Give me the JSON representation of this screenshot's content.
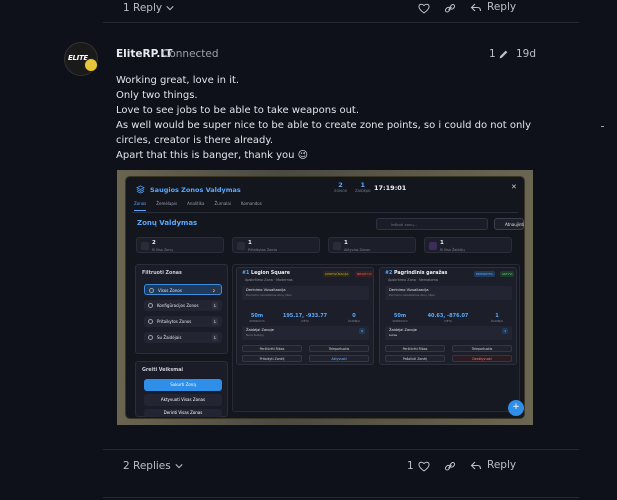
{
  "top_actions": {
    "replies_label": "1 Reply",
    "reply_label": "Reply"
  },
  "post": {
    "username": "EliteRP.LT",
    "status": "Connected",
    "avatar_text": "ELITE",
    "edit_count": "1",
    "date": "19d",
    "body": [
      "Working great, love in it.",
      "Only two things.",
      "Love to see jobs to be able to take weapons out.",
      "As well would be super nice to be able to create zone points, so i could do not only circles, creator is there already.",
      "Apart that this is banger, thank you 😉"
    ]
  },
  "screenshot": {
    "title": "Saugios Zonos Valdymas",
    "header_stats": [
      {
        "value": "2",
        "label": "ZONOS"
      },
      {
        "value": "1",
        "label": "ŽAIDĖJAI"
      }
    ],
    "clock": "17:19:01",
    "tabs": [
      "Zonos",
      "Žemėlapis",
      "Analitika",
      "Žurnalai",
      "Komandos"
    ],
    "section_title": "Zonų Valdymas",
    "search_placeholder": "Ieškoti zonų...",
    "refresh_label": "Atnaujinti",
    "summary_cards": [
      {
        "value": "2",
        "label": "Iš Viso Zonų"
      },
      {
        "value": "1",
        "label": "Pritaikytos Zonos"
      },
      {
        "value": "1",
        "label": "Aktyvios Zonos"
      },
      {
        "value": "1",
        "label": "Iš Viso Žaidėjų"
      }
    ],
    "filters": {
      "heading": "Filtruoti Zonas",
      "items": [
        {
          "label": "Visos Zonos",
          "count": "2"
        },
        {
          "label": "Konfigūracijos Zonos",
          "count": "1"
        },
        {
          "label": "Pritaikytos Zonos",
          "count": "1"
        },
        {
          "label": "Su Žaidėjais",
          "count": "1"
        }
      ]
    },
    "quick_actions": {
      "heading": "Greiti Veiksmai",
      "create": "Sukurti Zoną",
      "activate_all": "Aktyvuoti Visas Zonas",
      "disable_all": "Derinti Visas Zonas"
    },
    "zones": [
      {
        "id": "#1",
        "name": "Legion Square",
        "subtitle": "Apskritimo Zona · Modernas",
        "tags": [
          "KONFIGŪRACIJA",
          "NEAKTYVI"
        ],
        "vis_title": "Derinimo Vizualizacija",
        "vis_sub": "Derinimo nematomas zonų ribos",
        "stats": [
          {
            "value": "50m",
            "key": "SPINDULYS"
          },
          {
            "value": "195.17, -933.77",
            "key": "VIETA"
          },
          {
            "value": "0",
            "key": "ŽAIDĖJAI"
          }
        ],
        "players_label": "Žaidėjai Zonoje",
        "players_count": "0",
        "players_empty": "Nėra žaidėjų",
        "buttons": [
          "Peržiūrėti Ribas",
          "Teleportuotis",
          "Pritaikyti Zonėlį",
          "Aktyvuoti"
        ]
      },
      {
        "id": "#2",
        "name": "Pagrindinis garažas",
        "subtitle": "Apskritimo Zona · Nematoma",
        "tags": [
          "PRITAIKYTA",
          "AKTYVI"
        ],
        "vis_title": "Derinimo Vizualizacija",
        "vis_sub": "Derinimo nematomas zonų ribos",
        "stats": [
          {
            "value": "50m",
            "key": "SPINDULYS"
          },
          {
            "value": "40.63, -876.07",
            "key": "VIETA"
          },
          {
            "value": "1",
            "key": "ŽAIDĖJAI"
          }
        ],
        "players_label": "Žaidėjai Zonoje",
        "players_count": "1",
        "players_list": [
          "Lukas"
        ],
        "buttons": [
          "Peržiūrėti Ribas",
          "Teleportuotis",
          "Pašalinti Zonėlį",
          "Deaktyvuoti"
        ]
      }
    ],
    "fab": "+"
  },
  "bottom_actions": {
    "replies_label": "2 Replies",
    "like_count": "1",
    "reply_label": "Reply"
  },
  "colors": {
    "background": "#0f111a",
    "accent": "#5aa9ff",
    "fab": "#2f8fe8",
    "badge": "#e8c63a"
  }
}
